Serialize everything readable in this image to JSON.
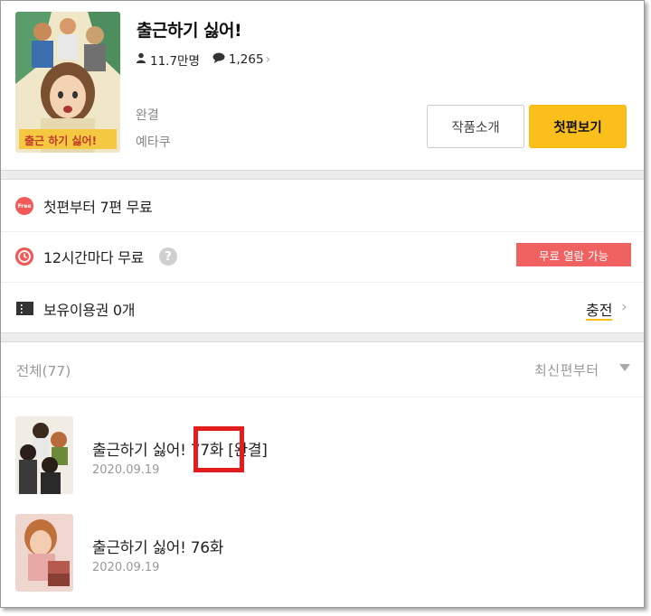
{
  "series": {
    "title": "출근하기 싫어!",
    "views": "11.7만명",
    "comments": "1,265",
    "status": "완결",
    "author": "예타쿠",
    "cover_text": "출근 하기 싫어!"
  },
  "buttons": {
    "intro": "작품소개",
    "first_episode": "첫편보기"
  },
  "info_rows": [
    {
      "icon_text": "Free",
      "label": "첫편부터 7편 무료"
    },
    {
      "label": "12시간마다 무료",
      "help": "?",
      "badge": "무료 열람 가능"
    },
    {
      "label": "보유이용권 0개",
      "action": "충전"
    }
  ],
  "list": {
    "total": "전체(77)",
    "sort": "최신편부터"
  },
  "episodes": [
    {
      "title": "출근하기 싫어! 77화 [완결]",
      "date": "2020.09.19"
    },
    {
      "title": "출근하기 싫어! 76화",
      "date": "2020.09.19"
    }
  ],
  "colors": {
    "accent_yellow": "#fbbf1c",
    "badge_red": "#f06262",
    "highlight_red": "#e11d1d"
  }
}
